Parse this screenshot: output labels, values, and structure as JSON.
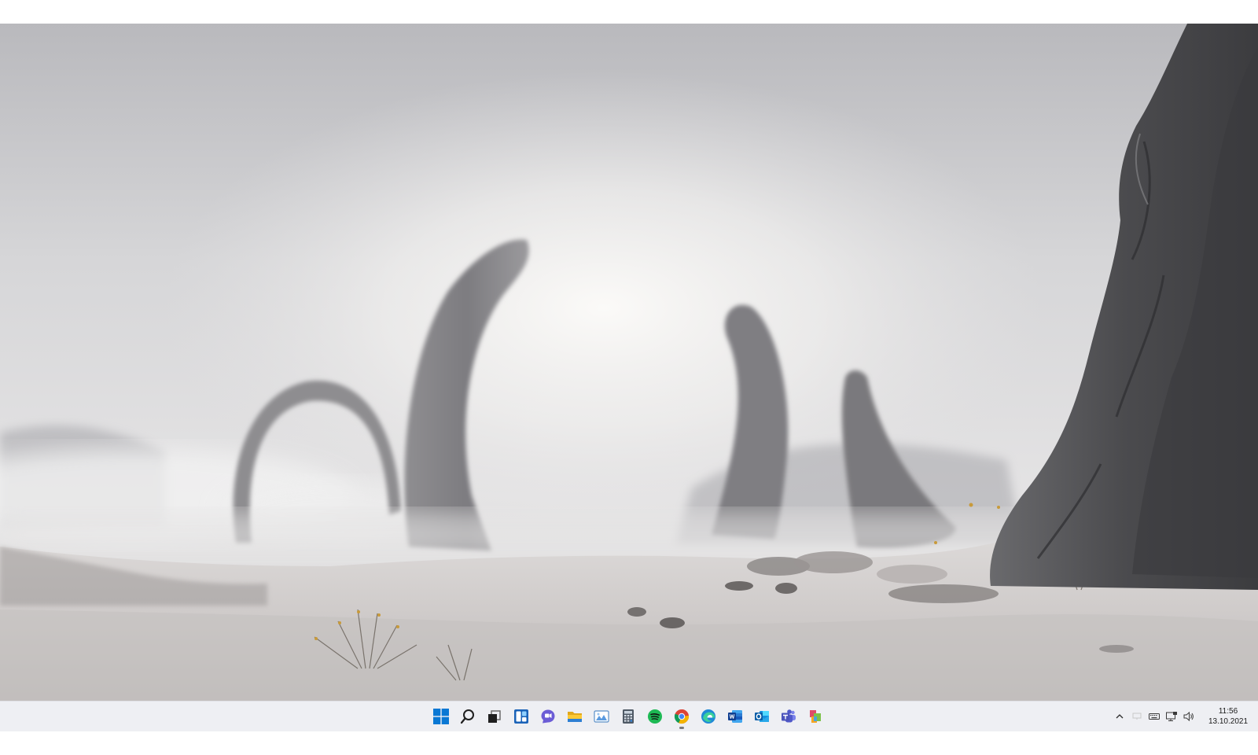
{
  "desktop": {
    "wallpaper": "misty-desert-arches",
    "colors": {
      "sky_top": "#c9c9cc",
      "sky_glow": "#f6f5f3",
      "ground": "#d3d0cf",
      "rock": "#4d4d50"
    }
  },
  "taskbar": {
    "background": "#eeeff3",
    "pinned": [
      {
        "id": "start",
        "icon": "windows-logo-icon"
      },
      {
        "id": "search",
        "icon": "search-icon"
      },
      {
        "id": "task-view",
        "icon": "task-view-icon"
      },
      {
        "id": "widgets",
        "icon": "widgets-icon"
      },
      {
        "id": "chat",
        "icon": "chat-icon"
      },
      {
        "id": "file-explorer",
        "icon": "folder-icon"
      },
      {
        "id": "photos",
        "icon": "photos-icon"
      },
      {
        "id": "calculator",
        "icon": "calculator-icon"
      },
      {
        "id": "spotify",
        "icon": "spotify-icon"
      },
      {
        "id": "chrome",
        "icon": "chrome-icon",
        "running": true
      },
      {
        "id": "edge",
        "icon": "edge-icon"
      },
      {
        "id": "word",
        "icon": "word-icon"
      },
      {
        "id": "outlook",
        "icon": "outlook-icon"
      },
      {
        "id": "teams",
        "icon": "teams-icon"
      },
      {
        "id": "paint-3d",
        "icon": "paint-3d-icon"
      }
    ],
    "tray": {
      "icons": [
        "chevron-up-icon",
        "display-icon",
        "keyboard-icon",
        "network-icon",
        "volume-icon"
      ],
      "time": "11:56",
      "date": "13.10.2021"
    }
  }
}
